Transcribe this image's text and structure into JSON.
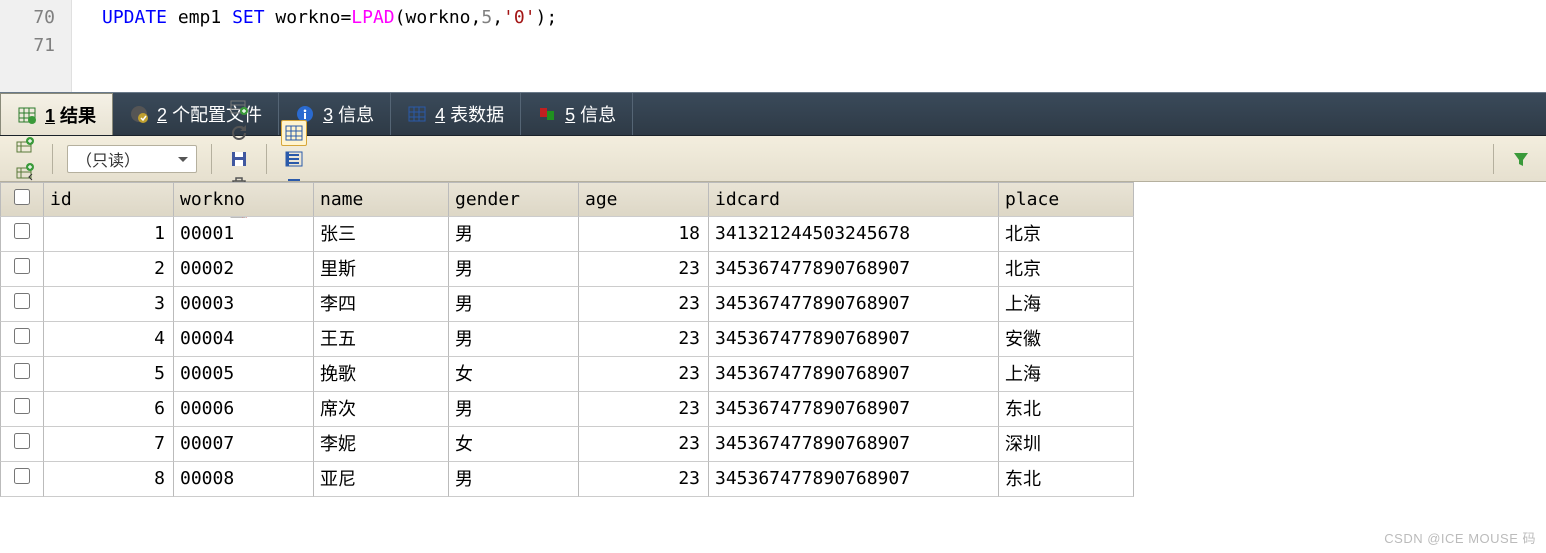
{
  "editor": {
    "lines": [
      {
        "num": "70",
        "tokens": [
          {
            "t": "kw",
            "v": "UPDATE"
          },
          {
            "t": "norm",
            "v": " emp1 "
          },
          {
            "t": "kw",
            "v": "SET"
          },
          {
            "t": "norm",
            "v": " workno"
          },
          {
            "t": "norm",
            "v": "="
          },
          {
            "t": "fn",
            "v": "LPAD"
          },
          {
            "t": "norm",
            "v": "(workno,"
          },
          {
            "t": "num",
            "v": "5"
          },
          {
            "t": "norm",
            "v": ","
          },
          {
            "t": "str",
            "v": "'0'"
          },
          {
            "t": "norm",
            "v": ");"
          }
        ]
      },
      {
        "num": "71",
        "tokens": []
      }
    ]
  },
  "tabs": [
    {
      "icon": "grid-green",
      "prefix": "1",
      "label": "结果",
      "active": true
    },
    {
      "icon": "profile",
      "prefix": "2",
      "label": "个配置文件",
      "active": false
    },
    {
      "icon": "info-blue",
      "prefix": "3",
      "label": "信息",
      "active": false
    },
    {
      "icon": "grid-blue",
      "prefix": "4",
      "label": "表数据",
      "active": false
    },
    {
      "icon": "flags",
      "prefix": "5",
      "label": "信息",
      "active": false
    }
  ],
  "toolbar": {
    "mode_label": "（只读）",
    "buttons_left": [
      "insert-row-icon",
      "insert-rows-icon"
    ],
    "buttons_mid": [
      "add-row-icon",
      "refresh-icon",
      "save-icon",
      "delete-icon",
      "clear-icon"
    ],
    "buttons_view": [
      "grid-view-icon",
      "form-view-icon",
      "text-view-icon"
    ],
    "active_view": "grid-view-icon",
    "filter_icon": "filter-icon"
  },
  "table": {
    "headers": [
      "",
      "id",
      "workno",
      "name",
      "gender",
      "age",
      "idcard",
      "place"
    ],
    "rows": [
      {
        "id": "1",
        "workno": "00001",
        "name": "张三",
        "gender": "男",
        "age": "18",
        "idcard": "341321244503245678",
        "place": "北京"
      },
      {
        "id": "2",
        "workno": "00002",
        "name": "里斯",
        "gender": "男",
        "age": "23",
        "idcard": "345367477890768907",
        "place": "北京"
      },
      {
        "id": "3",
        "workno": "00003",
        "name": "李四",
        "gender": "男",
        "age": "23",
        "idcard": "345367477890768907",
        "place": "上海"
      },
      {
        "id": "4",
        "workno": "00004",
        "name": "王五",
        "gender": "男",
        "age": "23",
        "idcard": "345367477890768907",
        "place": "安徽"
      },
      {
        "id": "5",
        "workno": "00005",
        "name": "挽歌",
        "gender": "女",
        "age": "23",
        "idcard": "345367477890768907",
        "place": "上海"
      },
      {
        "id": "6",
        "workno": "00006",
        "name": "席次",
        "gender": "男",
        "age": "23",
        "idcard": "345367477890768907",
        "place": "东北"
      },
      {
        "id": "7",
        "workno": "00007",
        "name": "李妮",
        "gender": "女",
        "age": "23",
        "idcard": "345367477890768907",
        "place": "深圳"
      },
      {
        "id": "8",
        "workno": "00008",
        "name": "亚尼",
        "gender": "男",
        "age": "23",
        "idcard": "345367477890768907",
        "place": "东北"
      }
    ]
  },
  "watermark": "CSDN @ICE MOUSE 码"
}
